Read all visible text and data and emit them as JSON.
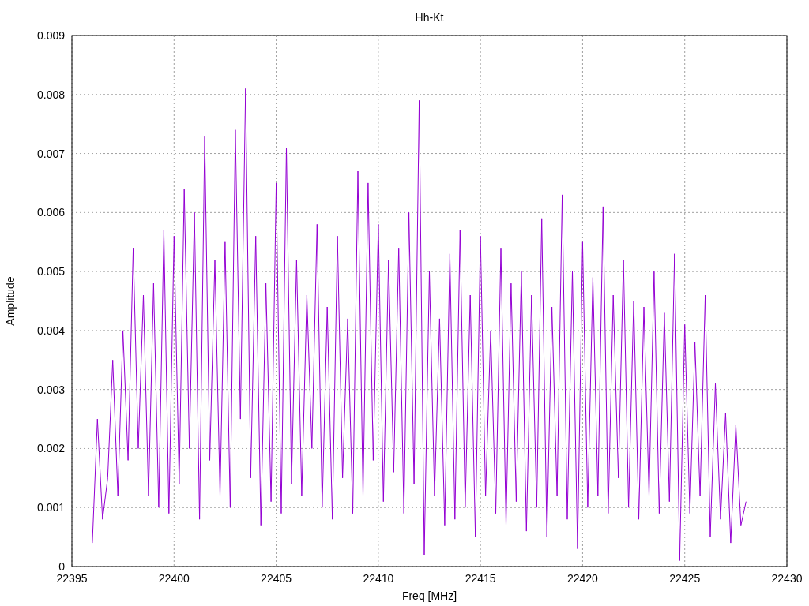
{
  "chart_data": {
    "type": "line",
    "title": "Hh-Kt",
    "xlabel": "Freq [MHz]",
    "ylabel": "Amplitude",
    "xlim": [
      22395,
      22430
    ],
    "ylim": [
      0,
      0.009
    ],
    "grid": true,
    "xticks": [
      22395,
      22400,
      22405,
      22410,
      22415,
      22420,
      22425,
      22430
    ],
    "yticks": [
      {
        "value": 0,
        "label": "0"
      },
      {
        "value": 0.001,
        "label": "0.001"
      },
      {
        "value": 0.002,
        "label": "0.002"
      },
      {
        "value": 0.003,
        "label": "0.003"
      },
      {
        "value": 0.004,
        "label": "0.004"
      },
      {
        "value": 0.005,
        "label": "0.005"
      },
      {
        "value": 0.006,
        "label": "0.006"
      },
      {
        "value": 0.007,
        "label": "0.007"
      },
      {
        "value": 0.008,
        "label": "0.008"
      },
      {
        "value": 0.009,
        "label": "0.009"
      }
    ],
    "x": [
      22396,
      22396.25,
      22396.5,
      22396.75,
      22397,
      22397.25,
      22397.5,
      22397.75,
      22398,
      22398.25,
      22398.5,
      22398.75,
      22399,
      22399.25,
      22399.5,
      22399.75,
      22400,
      22400.25,
      22400.5,
      22400.75,
      22401,
      22401.25,
      22401.5,
      22401.75,
      22402,
      22402.25,
      22402.5,
      22402.75,
      22403,
      22403.25,
      22403.5,
      22403.75,
      22404,
      22404.25,
      22404.5,
      22404.75,
      22405,
      22405.25,
      22405.5,
      22405.75,
      22406,
      22406.25,
      22406.5,
      22406.75,
      22407,
      22407.25,
      22407.5,
      22407.75,
      22408,
      22408.25,
      22408.5,
      22408.75,
      22409,
      22409.25,
      22409.5,
      22409.75,
      22410,
      22410.25,
      22410.5,
      22410.75,
      22411,
      22411.25,
      22411.5,
      22411.75,
      22412,
      22412.25,
      22412.5,
      22412.75,
      22413,
      22413.25,
      22413.5,
      22413.75,
      22414,
      22414.25,
      22414.5,
      22414.75,
      22415,
      22415.25,
      22415.5,
      22415.75,
      22416,
      22416.25,
      22416.5,
      22416.75,
      22417,
      22417.25,
      22417.5,
      22417.75,
      22418,
      22418.25,
      22418.5,
      22418.75,
      22419,
      22419.25,
      22419.5,
      22419.75,
      22420,
      22420.25,
      22420.5,
      22420.75,
      22421,
      22421.25,
      22421.5,
      22421.75,
      22422,
      22422.25,
      22422.5,
      22422.75,
      22423,
      22423.25,
      22423.5,
      22423.75,
      22424,
      22424.25,
      22424.5,
      22424.75,
      22425,
      22425.25,
      22425.5,
      22425.75,
      22426,
      22426.25,
      22426.5,
      22426.75,
      22427,
      22427.25,
      22427.5,
      22427.75,
      22428
    ],
    "series": [
      {
        "color": "#9400d3",
        "values": [
          0.0004,
          0.0025,
          0.0008,
          0.0015,
          0.0035,
          0.0012,
          0.004,
          0.0018,
          0.0054,
          0.002,
          0.0046,
          0.0012,
          0.0048,
          0.001,
          0.0057,
          0.0009,
          0.0056,
          0.0014,
          0.0064,
          0.002,
          0.006,
          0.0008,
          0.0073,
          0.0018,
          0.0052,
          0.0012,
          0.0055,
          0.001,
          0.0074,
          0.0025,
          0.0081,
          0.0015,
          0.0056,
          0.0007,
          0.0048,
          0.0011,
          0.0065,
          0.0009,
          0.0071,
          0.0014,
          0.0052,
          0.0012,
          0.0046,
          0.002,
          0.0058,
          0.001,
          0.0044,
          0.0008,
          0.0056,
          0.0015,
          0.0042,
          0.0009,
          0.0067,
          0.0012,
          0.0065,
          0.0018,
          0.0058,
          0.0011,
          0.0052,
          0.0016,
          0.0054,
          0.0009,
          0.006,
          0.0014,
          0.0079,
          0.0002,
          0.005,
          0.0012,
          0.0042,
          0.0007,
          0.0053,
          0.0008,
          0.0057,
          0.001,
          0.0046,
          0.0005,
          0.0056,
          0.0012,
          0.004,
          0.0009,
          0.0054,
          0.0007,
          0.0048,
          0.0011,
          0.005,
          0.0006,
          0.0046,
          0.001,
          0.0059,
          0.0005,
          0.0044,
          0.0012,
          0.0063,
          0.0008,
          0.005,
          0.0003,
          0.0055,
          0.001,
          0.0049,
          0.0012,
          0.0061,
          0.0009,
          0.0046,
          0.0015,
          0.0052,
          0.001,
          0.0045,
          0.0008,
          0.0044,
          0.0012,
          0.005,
          0.0009,
          0.0043,
          0.0011,
          0.0053,
          0.0001,
          0.0041,
          0.0009,
          0.0038,
          0.0012,
          0.0046,
          0.0005,
          0.0031,
          0.0008,
          0.0026,
          0.0004,
          0.0024,
          0.0007,
          0.0011
        ]
      }
    ]
  }
}
